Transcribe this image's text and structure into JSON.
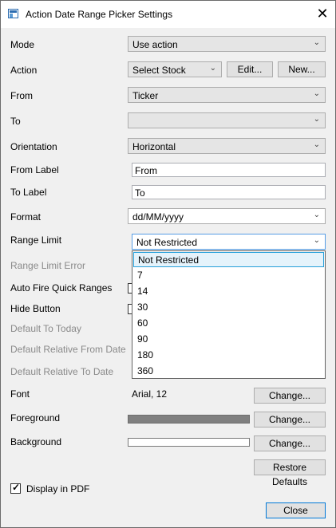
{
  "window": {
    "title": "Action Date Range Picker Settings",
    "close_glyph": "✕"
  },
  "labels": {
    "mode": "Mode",
    "action": "Action",
    "from": "From",
    "to": "To",
    "orientation": "Orientation",
    "from_label": "From Label",
    "to_label": "To Label",
    "format": "Format",
    "range_limit": "Range Limit",
    "range_limit_error": "Range Limit Error",
    "auto_fire": "Auto Fire Quick Ranges",
    "hide_button": "Hide Button",
    "default_to_today": "Default To Today",
    "default_rel_from": "Default Relative From Date",
    "default_rel_to": "Default Relative To Date",
    "font": "Font",
    "foreground": "Foreground",
    "background": "Background"
  },
  "fields": {
    "mode_value": "Use action",
    "action_value": "Select Stock",
    "from_value": "Ticker",
    "to_value": "",
    "orientation_value": "Horizontal",
    "from_label_value": "From",
    "to_label_value": "To",
    "format_value": "dd/MM/yyyy",
    "range_limit_value": "Not Restricted",
    "font_value": "Arial, 12"
  },
  "buttons": {
    "edit": "Edit...",
    "new": "New...",
    "font_change": "Change...",
    "foreground_change": "Change...",
    "background_change": "Change...",
    "restore_defaults": "Restore Defaults",
    "close": "Close"
  },
  "dropdown": {
    "options": [
      "Not Restricted",
      "7",
      "14",
      "30",
      "60",
      "90",
      "180",
      "360"
    ],
    "selected": "Not Restricted"
  },
  "display_in_pdf": {
    "label": "Display in PDF",
    "checked": true
  },
  "colors": {
    "foreground": "#808080",
    "background": "#ffffff",
    "accent": "#0078d7"
  },
  "icons": {
    "chevron": "⌄",
    "check": "✓"
  }
}
